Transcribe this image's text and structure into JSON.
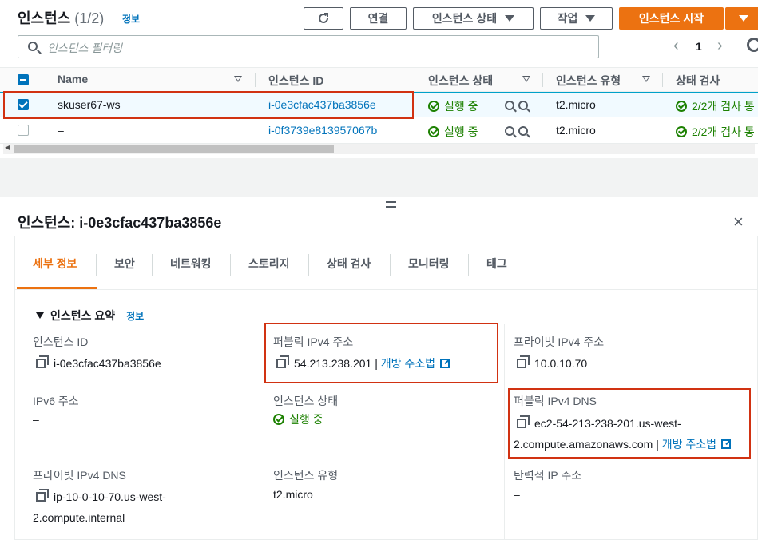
{
  "header": {
    "title": "인스턴스",
    "count": "(1/2)",
    "info": "정보",
    "refresh_icon": "refresh-icon",
    "connect": "연결",
    "instance_state": "인스턴스 상태",
    "actions": "작업",
    "launch": "인스턴스 시작"
  },
  "search": {
    "placeholder": "인스턴스 필터링"
  },
  "pager": {
    "prev": "‹",
    "page": "1",
    "next": "›"
  },
  "table": {
    "headers": [
      "Name",
      "인스턴스 ID",
      "인스턴스 상태",
      "인스턴스 유형",
      "상태 검사"
    ],
    "rows": [
      {
        "name": "skuser67-ws",
        "id": "i-0e3cfac437ba3856e",
        "state": "실행 중",
        "type": "t2.micro",
        "check": "2/2개 검사 통",
        "selected": true
      },
      {
        "name": "–",
        "id": "i-0f3739e813957067b",
        "state": "실행 중",
        "type": "t2.micro",
        "check": "2/2개 검사 통",
        "selected": false
      }
    ]
  },
  "detail": {
    "title": "인스턴스: i-0e3cfac437ba3856e",
    "close": "×",
    "tabs": [
      "세부 정보",
      "보안",
      "네트워킹",
      "스토리지",
      "상태 검사",
      "모니터링",
      "태그"
    ],
    "summary": "인스턴스 요약",
    "summary_info": "정보",
    "fields": {
      "instance_id_label": "인스턴스 ID",
      "instance_id": "i-0e3cfac437ba3856e",
      "public_ip_label": "퍼블릭 IPv4 주소",
      "public_ip": "54.213.238.201",
      "open_addr": "개방 주소법",
      "private_ip_label": "프라이빗 IPv4 주소",
      "private_ip": "10.0.10.70",
      "ipv6_label": "IPv6 주소",
      "ipv6": "–",
      "state_label": "인스턴스 상태",
      "state": "실행 중",
      "public_dns_label": "퍼블릭 IPv4 DNS",
      "public_dns_1": "ec2-54-213-238-201.us-west-",
      "public_dns_2": "2.compute.amazonaws.com",
      "private_dns_label": "프라이빗 IPv4 DNS",
      "private_dns_1": "ip-10-0-10-70.us-west-",
      "private_dns_2": "2.compute.internal",
      "type_label": "인스턴스 유형",
      "type": "t2.micro",
      "eip_label": "탄력적 IP 주소",
      "eip": "–"
    }
  },
  "colors": {
    "accent": "#ec7211",
    "link": "#0073bb",
    "ok": "#1d8102",
    "highlight": "#d13212"
  }
}
